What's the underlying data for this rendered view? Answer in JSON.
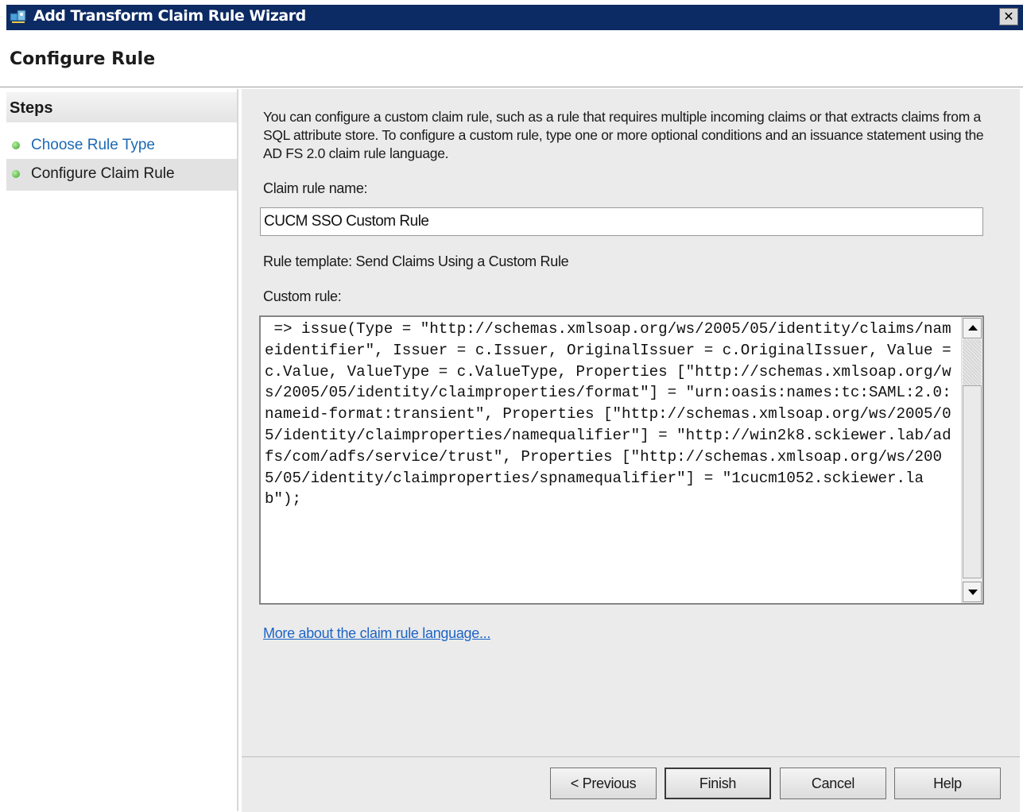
{
  "window": {
    "title": "Add Transform Claim Rule Wizard",
    "close_glyph": "✕"
  },
  "header": {
    "page_title": "Configure Rule"
  },
  "steps": {
    "title": "Steps",
    "items": [
      {
        "label": "Choose Rule Type",
        "state": "completed-link"
      },
      {
        "label": "Configure Claim Rule",
        "state": "current"
      }
    ]
  },
  "main": {
    "description": "You can configure a custom claim rule, such as a rule that requires multiple incoming claims or that extracts claims from a SQL attribute store. To configure a custom rule, type one or more optional conditions and an issuance statement using the AD FS 2.0 claim rule language.",
    "claim_rule_name_label": "Claim rule name:",
    "claim_rule_name_value": "CUCM SSO Custom Rule",
    "rule_template": "Rule template: Send Claims Using a Custom Rule",
    "custom_rule_label": "Custom rule:",
    "custom_rule_text": " => issue(Type = \"http://schemas.xmlsoap.org/ws/2005/05/identity/claims/nameidentifier\", Issuer = c.Issuer, OriginalIssuer = c.OriginalIssuer, Value = c.Value, ValueType = c.ValueType, Properties [\"http://schemas.xmlsoap.org/ws/2005/05/identity/claimproperties/format\"] = \"urn:oasis:names:tc:SAML:2.0:nameid-format:transient\", Properties [\"http://schemas.xmlsoap.org/ws/2005/05/identity/claimproperties/namequalifier\"] = \"http://win2k8.sckiewer.lab/adfs/com/adfs/service/trust\", Properties [\"http://schemas.xmlsoap.org/ws/2005/05/identity/claimproperties/spnamequalifier\"] = \"1cucm1052.sckiewer.lab\");",
    "more_link": "More about the claim rule language..."
  },
  "footer": {
    "previous_label": "< Previous",
    "finish_label": "Finish",
    "cancel_label": "Cancel",
    "help_label": "Help"
  },
  "colors": {
    "titlebar": "#0c2a63",
    "link": "#1d64c6",
    "panel": "#ebebeb"
  }
}
